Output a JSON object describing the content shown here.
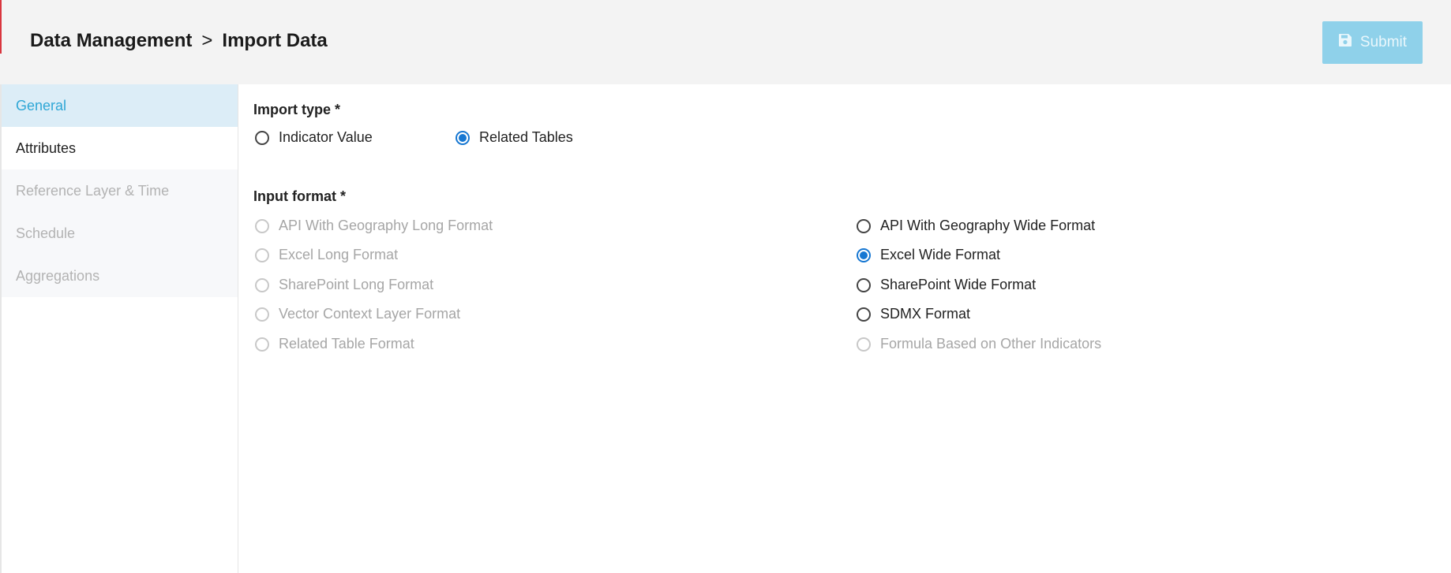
{
  "header": {
    "breadcrumb_root": "Data Management",
    "breadcrumb_separator": ">",
    "breadcrumb_current": "Import Data",
    "submit_label": "Submit",
    "submit_icon": "save-icon"
  },
  "sidebar": {
    "items": [
      {
        "label": "General",
        "state": "active"
      },
      {
        "label": "Attributes",
        "state": "enabled"
      },
      {
        "label": "Reference Layer & Time",
        "state": "disabled"
      },
      {
        "label": "Schedule",
        "state": "disabled"
      },
      {
        "label": "Aggregations",
        "state": "disabled"
      }
    ]
  },
  "import_type": {
    "label": "Import type *",
    "options": [
      {
        "label": "Indicator Value",
        "checked": false
      },
      {
        "label": "Related Tables",
        "checked": true
      }
    ]
  },
  "input_format": {
    "label": "Input format *",
    "left_options": [
      {
        "label": "API With Geography Long Format",
        "disabled": true
      },
      {
        "label": "Excel Long Format",
        "disabled": true
      },
      {
        "label": "SharePoint Long Format",
        "disabled": true
      },
      {
        "label": "Vector Context Layer Format",
        "disabled": true
      },
      {
        "label": "Related Table Format",
        "disabled": true
      }
    ],
    "right_options": [
      {
        "label": "API With Geography Wide Format",
        "disabled": false,
        "checked": false
      },
      {
        "label": "Excel Wide Format",
        "disabled": false,
        "checked": true
      },
      {
        "label": "SharePoint Wide Format",
        "disabled": false,
        "checked": false
      },
      {
        "label": "SDMX Format",
        "disabled": false,
        "checked": false
      },
      {
        "label": "Formula Based on Other Indicators",
        "disabled": true,
        "checked": false
      }
    ]
  },
  "colors": {
    "accent": "#2fa7d6",
    "radio_checked": "#1677d2",
    "submit_bg": "#8fd1ea",
    "header_bg": "#f3f3f3",
    "alert_bar": "#d9363e"
  }
}
